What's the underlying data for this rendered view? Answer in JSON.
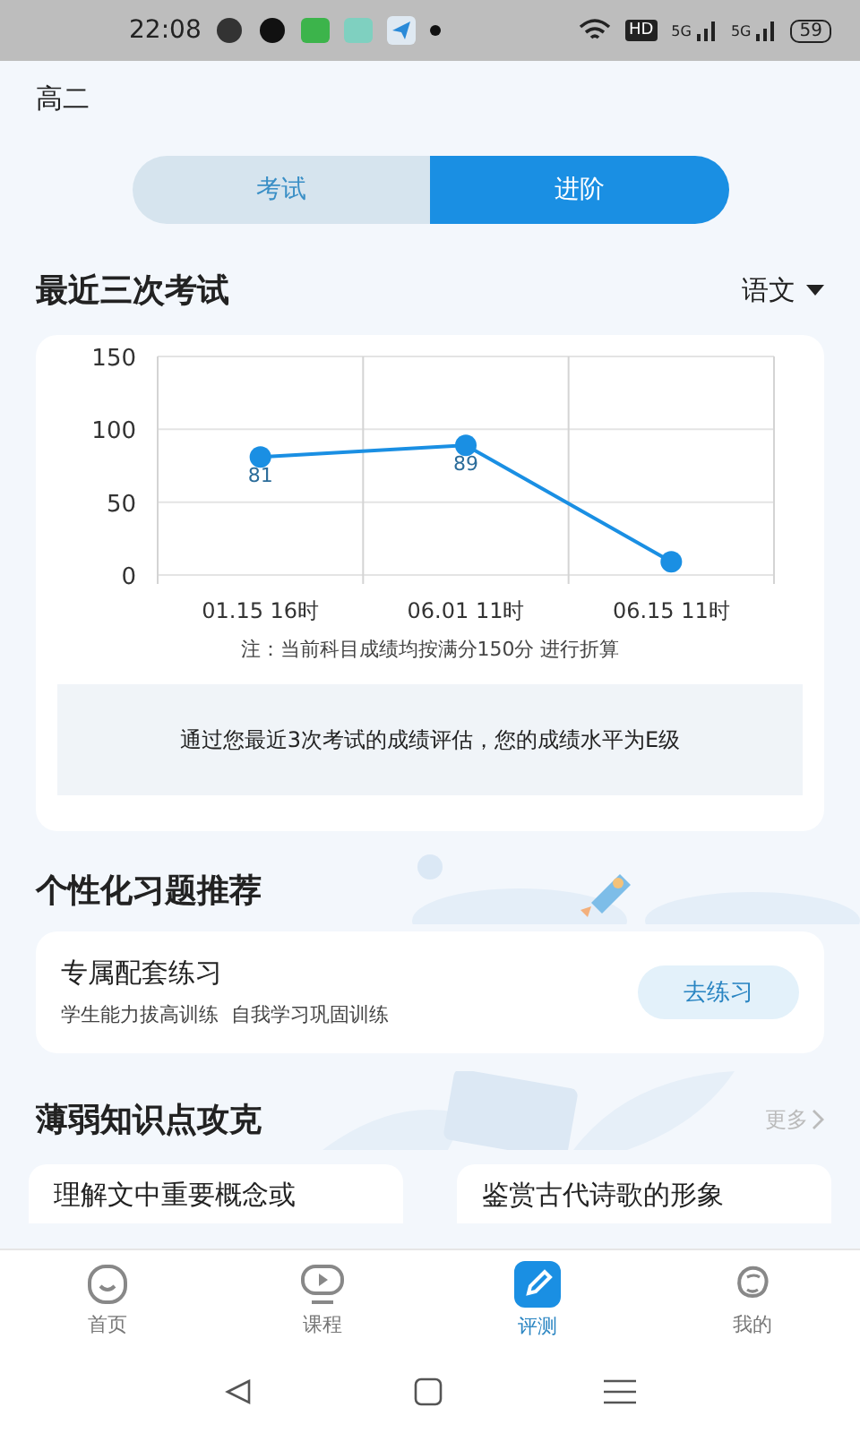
{
  "status_bar": {
    "time": "22:08",
    "network_badge": "HD",
    "signal_labels": [
      "5G",
      "5G"
    ],
    "battery": "59"
  },
  "grade": "高二",
  "mode_tabs": [
    {
      "label": "考试",
      "selected": false
    },
    {
      "label": "进阶",
      "selected": true
    }
  ],
  "recent_exams": {
    "title": "最近三次考试",
    "subject": "语文",
    "chart_data": {
      "type": "line",
      "categories": [
        "01.15 16时",
        "06.01 11时",
        "06.15 11时"
      ],
      "series": [
        {
          "color": "#1a8fe3",
          "marker": "circle",
          "values": [
            81,
            89,
            9
          ]
        }
      ],
      "ylim": [
        0,
        150
      ],
      "yticks": [
        0,
        50,
        100,
        150
      ],
      "value_labels": [
        "81",
        "89",
        null
      ]
    },
    "note": "注：当前科目成绩均按满分150分 进行折算",
    "assessment": "通过您最近3次考试的成绩评估，您的成绩水平为E级"
  },
  "practice": {
    "title": "个性化习题推荐",
    "card_title": "专属配套练习",
    "card_subtitle": "学生能力拔高训练  自我学习巩固训练",
    "button": "去练习"
  },
  "weak_points": {
    "title": "薄弱知识点攻克",
    "more": "更多",
    "cards": [
      "理解文中重要概念或",
      "鉴赏古代诗歌的形象"
    ]
  },
  "bottom_tabs": [
    {
      "label": "首页",
      "kind": "face",
      "selected": false
    },
    {
      "label": "课程",
      "kind": "play",
      "selected": false
    },
    {
      "label": "评测",
      "kind": "pencil",
      "selected": true
    },
    {
      "label": "我的",
      "kind": "person",
      "selected": false
    }
  ]
}
